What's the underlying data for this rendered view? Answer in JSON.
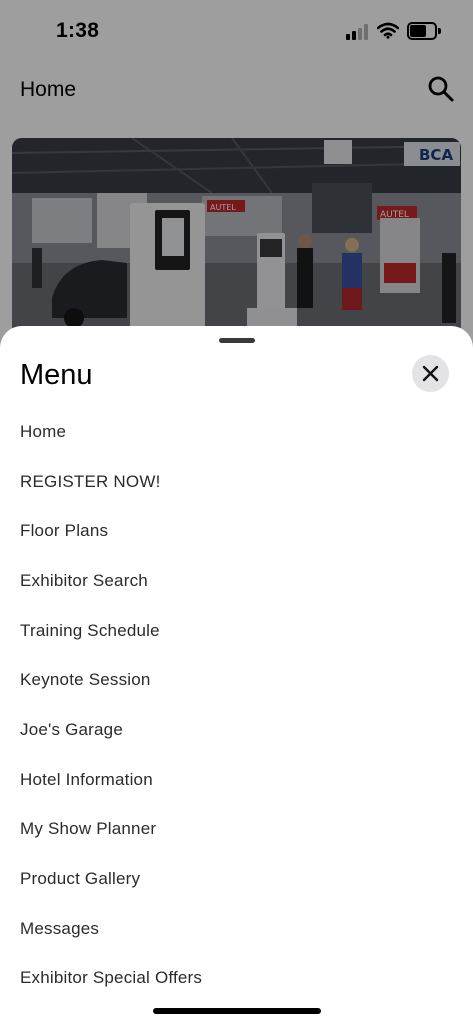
{
  "status_bar": {
    "time": "1:38",
    "signal_icon": "cellular-signal-icon",
    "wifi_icon": "wifi-icon",
    "battery_icon": "battery-icon",
    "battery_level": 0.55
  },
  "header": {
    "title": "Home",
    "search_icon": "search-icon"
  },
  "hero": {
    "image": "trade-show-floor-photo",
    "signs": [
      "AUTEL",
      "BCA"
    ]
  },
  "menu": {
    "title": "Menu",
    "close_icon": "close-icon",
    "items": [
      {
        "label": "Home"
      },
      {
        "label": "REGISTER NOW!"
      },
      {
        "label": "Floor Plans"
      },
      {
        "label": "Exhibitor Search"
      },
      {
        "label": "Training Schedule"
      },
      {
        "label": "Keynote Session"
      },
      {
        "label": "Joe's Garage"
      },
      {
        "label": "Hotel Information"
      },
      {
        "label": "My Show Planner"
      },
      {
        "label": "Product Gallery"
      },
      {
        "label": "Messages"
      },
      {
        "label": "Exhibitor Special Offers"
      }
    ]
  },
  "colors": {
    "overlay": "#000000",
    "sheet_background": "#ffffff",
    "close_button_bg": "#e3e3e6",
    "menu_text": "#2b2b2b"
  }
}
